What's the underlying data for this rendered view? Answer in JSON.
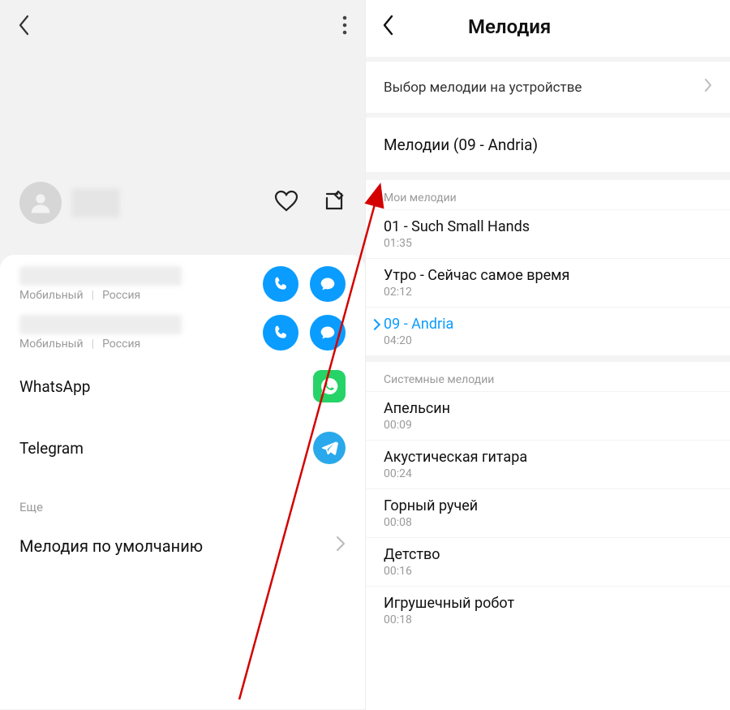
{
  "left": {
    "phone1": {
      "type": "Мобильный",
      "region": "Россия"
    },
    "phone2": {
      "type": "Мобильный",
      "region": "Россия"
    },
    "apps": {
      "whatsapp": "WhatsApp",
      "telegram": "Telegram"
    },
    "more_section": "Еще",
    "ringtone_setting": "Мелодия по умолчанию"
  },
  "right": {
    "title": "Мелодия",
    "device_picker": "Выбор мелодии на устройстве",
    "current": "Мелодии (09 - Andria)",
    "my_section": "Мои мелодии",
    "my_tracks": [
      {
        "title": "01 - Such Small Hands",
        "dur": "01:35"
      },
      {
        "title": "Утро - Сейчас самое время",
        "dur": "02:12"
      },
      {
        "title": "09 - Andria",
        "dur": "04:20"
      }
    ],
    "sys_section": "Системные мелодии",
    "sys_tracks": [
      {
        "title": "Апельсин",
        "dur": "00:09"
      },
      {
        "title": "Акустическая гитара",
        "dur": "00:24"
      },
      {
        "title": "Горный ручей",
        "dur": "00:08"
      },
      {
        "title": "Детство",
        "dur": "00:16"
      },
      {
        "title": "Игрушечный робот",
        "dur": "00:18"
      }
    ]
  }
}
